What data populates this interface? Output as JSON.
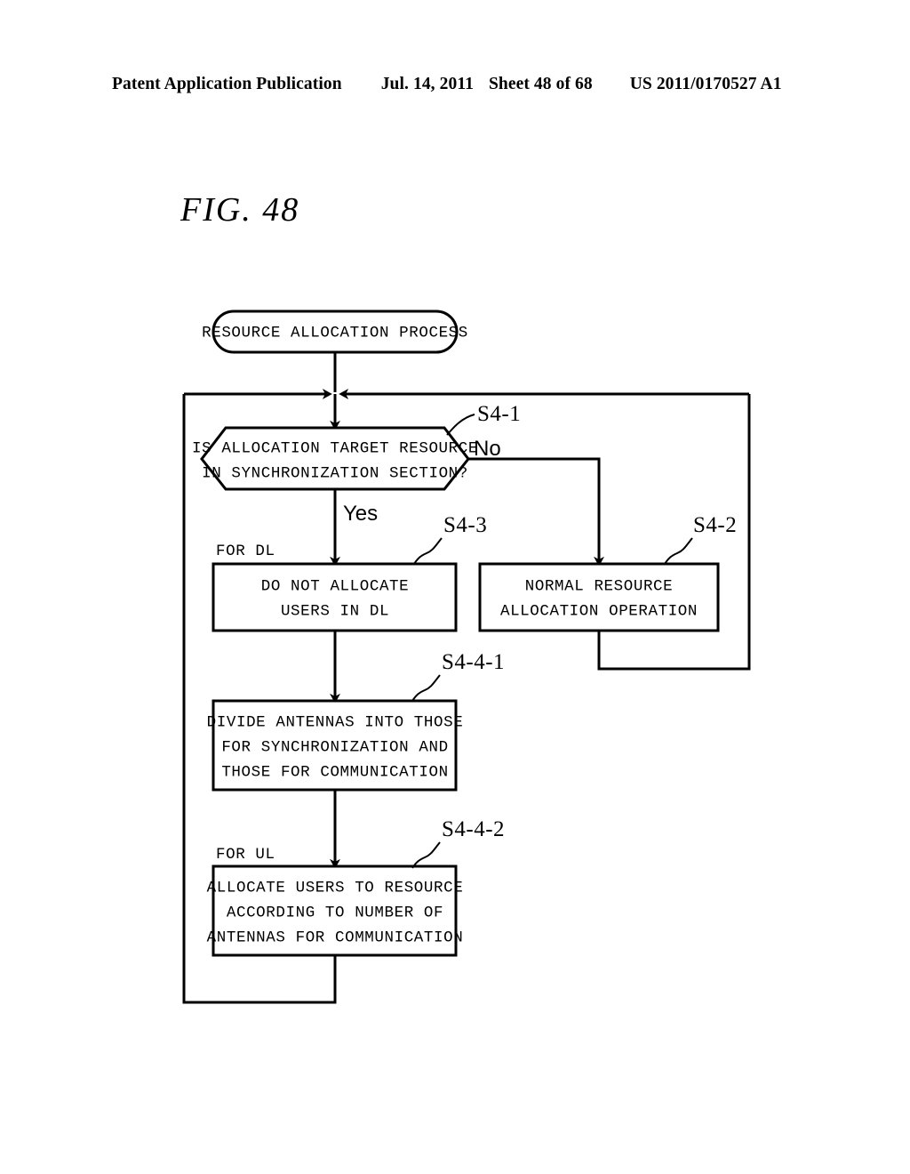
{
  "header": {
    "publication": "Patent Application Publication",
    "date": "Jul. 14, 2011",
    "sheet": "Sheet 48 of 68",
    "number": "US 2011/0170527 A1"
  },
  "figure": {
    "title": "FIG. 48"
  },
  "flowchart": {
    "start": {
      "label_line1": "RESOURCE ALLOCATION PROCESS"
    },
    "decision": {
      "step": "S4-1",
      "line1": "IS ALLOCATION TARGET RESOURCE",
      "line2": "IN SYNCHRONIZATION SECTION?",
      "yes_label": "Yes",
      "no_label": "No"
    },
    "notes": {
      "for_dl": "FOR DL",
      "for_ul": "FOR UL"
    },
    "boxes": [
      {
        "step": "S4-3",
        "lines": [
          "DO NOT ALLOCATE",
          "USERS IN DL"
        ]
      },
      {
        "step": "S4-2",
        "lines": [
          "NORMAL RESOURCE",
          "ALLOCATION OPERATION"
        ]
      },
      {
        "step": "S4-4-1",
        "lines": [
          "DIVIDE ANTENNAS INTO THOSE",
          "FOR SYNCHRONIZATION AND",
          "THOSE FOR COMMUNICATION"
        ]
      },
      {
        "step": "S4-4-2",
        "lines": [
          "ALLOCATE USERS TO RESOURCE",
          "ACCORDING TO NUMBER OF",
          "ANTENNAS FOR COMMUNICATION"
        ]
      }
    ]
  },
  "colors": {
    "ink": "#000000",
    "paper": "#ffffff"
  }
}
